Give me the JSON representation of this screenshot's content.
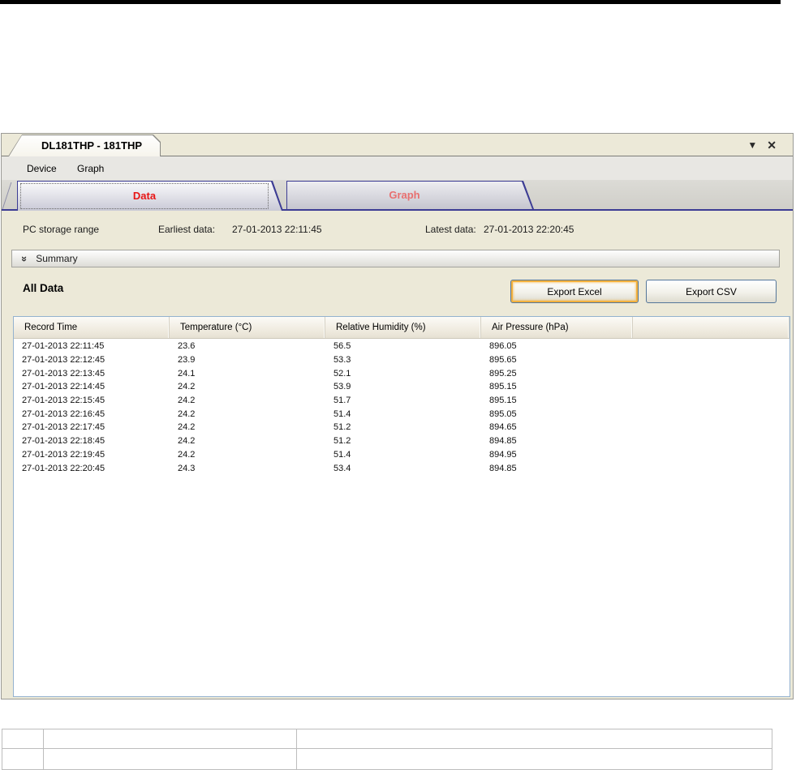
{
  "window": {
    "doc_tab_title": "DL181THP - 181THP",
    "dropdown_glyph": "▼",
    "close_glyph": "✕"
  },
  "menu": {
    "items": [
      {
        "label": "Device"
      },
      {
        "label": "Graph"
      }
    ]
  },
  "page_tabs": [
    {
      "label": "Data",
      "active": true
    },
    {
      "label": "Graph",
      "active": false
    }
  ],
  "storage": {
    "label": "PC storage range",
    "earliest_label": "Earliest data:",
    "earliest_value": "27-01-2013 22:11:45",
    "latest_label": "Latest data:",
    "latest_value": "27-01-2013 22:20:45"
  },
  "summary": {
    "chevron": "»",
    "label": "Summary"
  },
  "data_section": {
    "title": "All Data",
    "export_excel_label": "Export Excel",
    "export_csv_label": "Export CSV"
  },
  "table": {
    "headers": [
      "Record Time",
      "Temperature (°C)",
      "Relative Humidity (%)",
      "Air Pressure (hPa)",
      ""
    ],
    "rows": [
      [
        "27-01-2013 22:11:45",
        "23.6",
        "56.5",
        "896.05"
      ],
      [
        "27-01-2013 22:12:45",
        "23.9",
        "53.3",
        "895.65"
      ],
      [
        "27-01-2013 22:13:45",
        "24.1",
        "52.1",
        "895.25"
      ],
      [
        "27-01-2013 22:14:45",
        "24.2",
        "53.9",
        "895.15"
      ],
      [
        "27-01-2013 22:15:45",
        "24.2",
        "51.7",
        "895.15"
      ],
      [
        "27-01-2013 22:16:45",
        "24.2",
        "51.4",
        "895.05"
      ],
      [
        "27-01-2013 22:17:45",
        "24.2",
        "51.2",
        "894.65"
      ],
      [
        "27-01-2013 22:18:45",
        "24.2",
        "51.2",
        "894.85"
      ],
      [
        "27-01-2013 22:19:45",
        "24.2",
        "51.4",
        "894.95"
      ],
      [
        "27-01-2013 22:20:45",
        "24.3",
        "53.4",
        "894.85"
      ]
    ]
  },
  "colors": {
    "active_tab_text": "#e81515",
    "inactive_tab_text": "#e87070",
    "tab_border_navy": "#3c3c94",
    "window_beige": "#ece9d8",
    "excel_focus_orange": "#f3b13e",
    "list_border_blue": "#94b2cf"
  }
}
